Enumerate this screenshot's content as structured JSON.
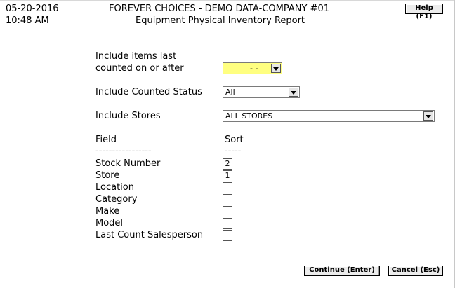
{
  "header": {
    "date": "05-20-2016",
    "time": "10:48 AM",
    "company": "FOREVER CHOICES - DEMO DATA-COMPANY #01",
    "report_title": "Equipment Physical Inventory Report",
    "help_label": "Help (F1)"
  },
  "form": {
    "last_counted_label_line1": "Include items last",
    "last_counted_label_line2": "counted on or after",
    "last_counted_value": "- -",
    "counted_status_label": "Include Counted Status",
    "counted_status_value": "All",
    "stores_label": "Include Stores",
    "stores_value": "ALL STORES",
    "highlight_color": "#ffff80"
  },
  "sort": {
    "field_header": "Field",
    "sort_header": "Sort",
    "field_divider": "-----------------",
    "sort_divider": "-----",
    "rows": [
      {
        "field": "Stock Number",
        "sort": "2"
      },
      {
        "field": "Store",
        "sort": "1"
      },
      {
        "field": "Location",
        "sort": ""
      },
      {
        "field": "Category",
        "sort": ""
      },
      {
        "field": "Make",
        "sort": ""
      },
      {
        "field": "Model",
        "sort": ""
      },
      {
        "field": "Last Count Salesperson",
        "sort": ""
      }
    ]
  },
  "buttons": {
    "continue_label": "Continue (Enter)",
    "cancel_label": "Cancel (Esc)"
  }
}
